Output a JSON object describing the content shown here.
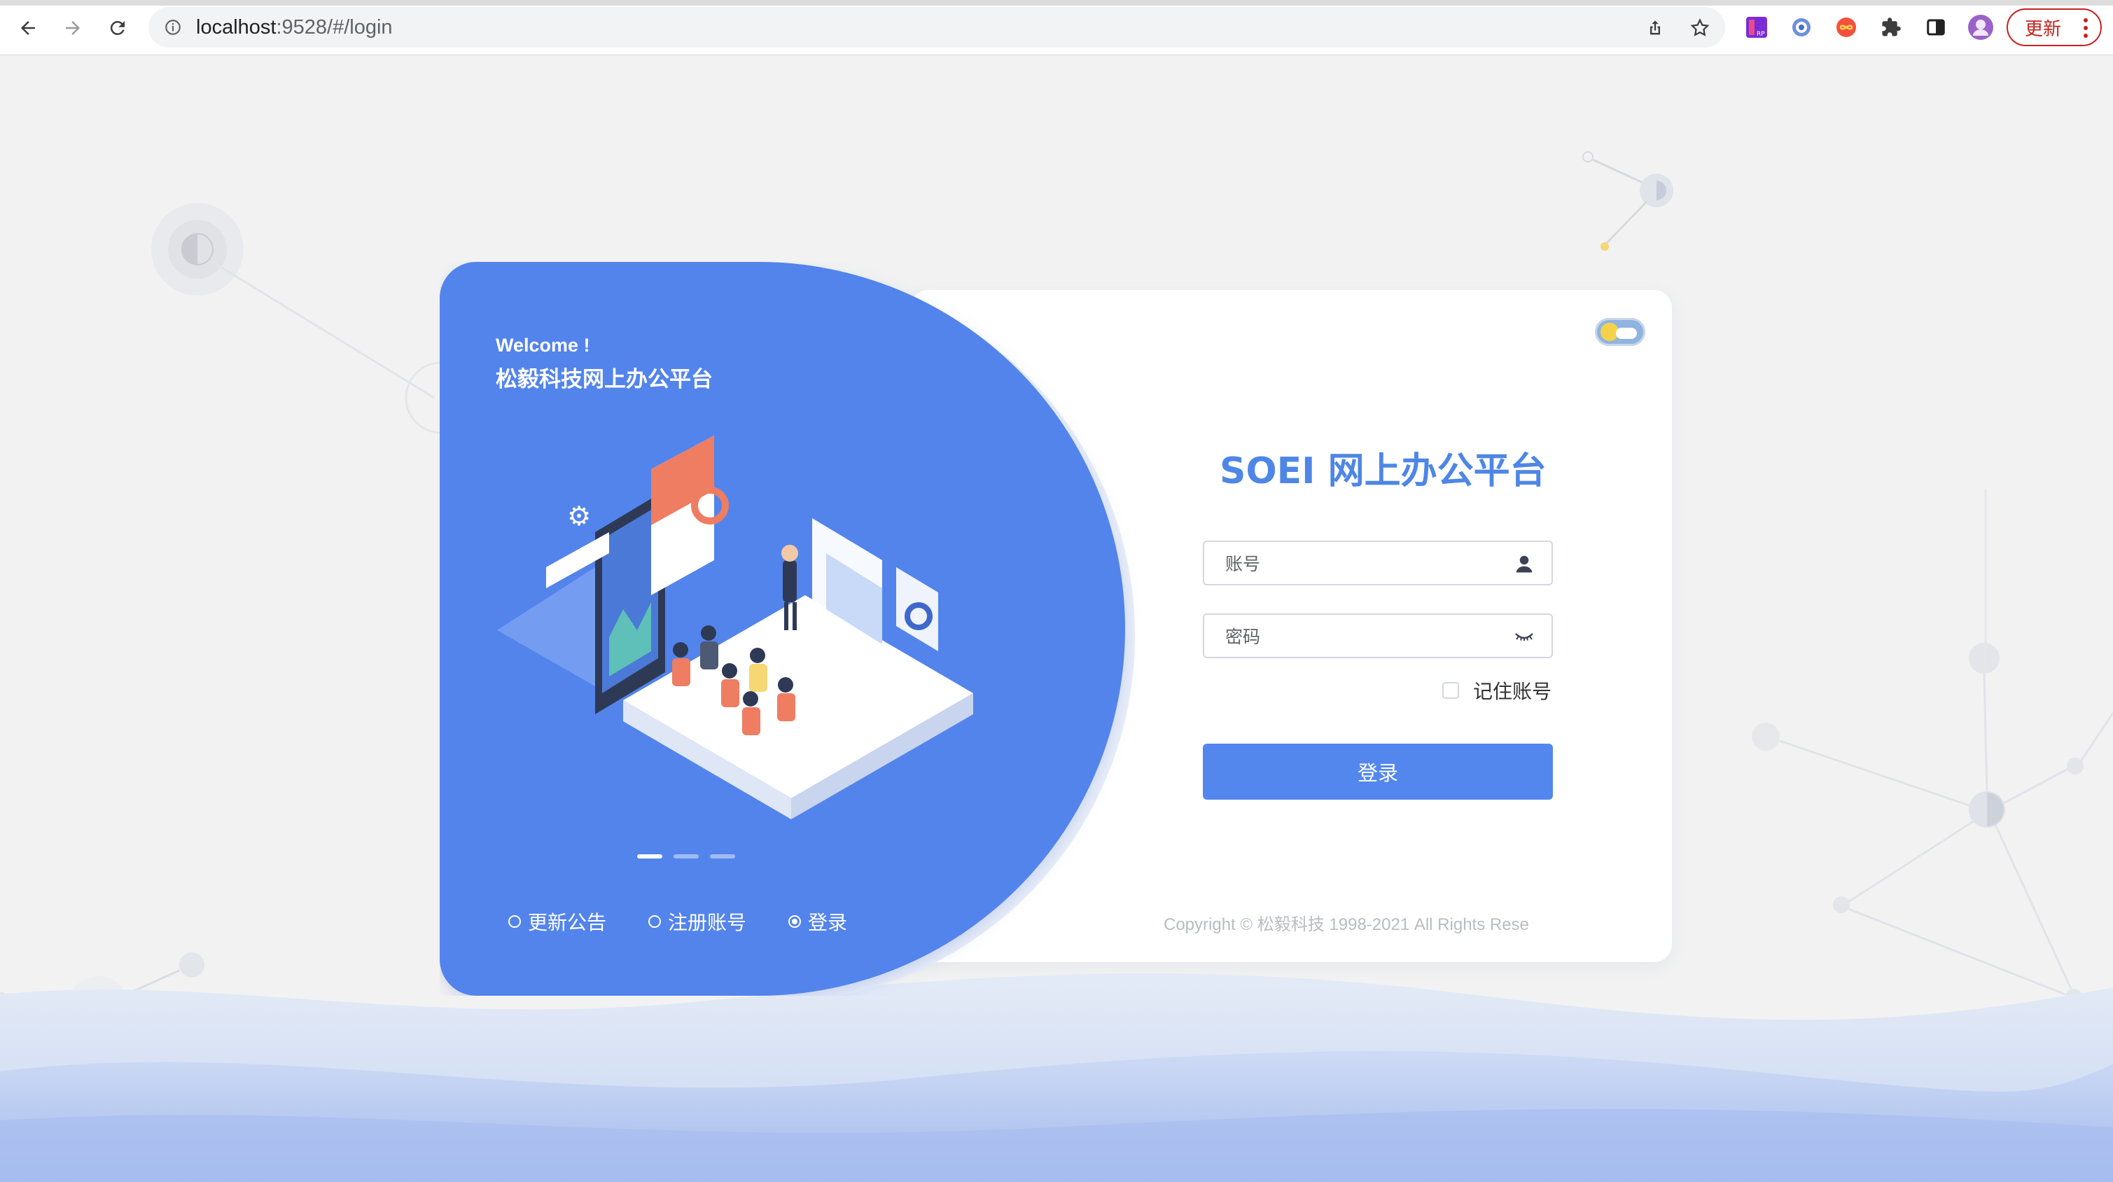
{
  "browser": {
    "url_host": "localhost",
    "url_path": ":9528/#/login",
    "update_label": "更新"
  },
  "left_panel": {
    "welcome": "Welcome !",
    "platform_name": "松毅科技网上办公平台",
    "links": [
      {
        "label": "更新公告",
        "checked": false
      },
      {
        "label": "注册账号",
        "checked": false
      },
      {
        "label": "登录",
        "checked": true
      }
    ],
    "carousel_active_index": 0,
    "carousel_count": 3
  },
  "form": {
    "title": "SOEI 网上办公平台",
    "username_placeholder": "账号",
    "password_placeholder": "密码",
    "remember_label": "记住账号",
    "login_label": "登录",
    "copyright": "Copyright © 松毅科技 1998-2021 All Rights Rese"
  },
  "colors": {
    "primary": "#5387ee",
    "title": "#4e86e6",
    "panel": "#5384ec",
    "background": "#f2f2f2"
  }
}
